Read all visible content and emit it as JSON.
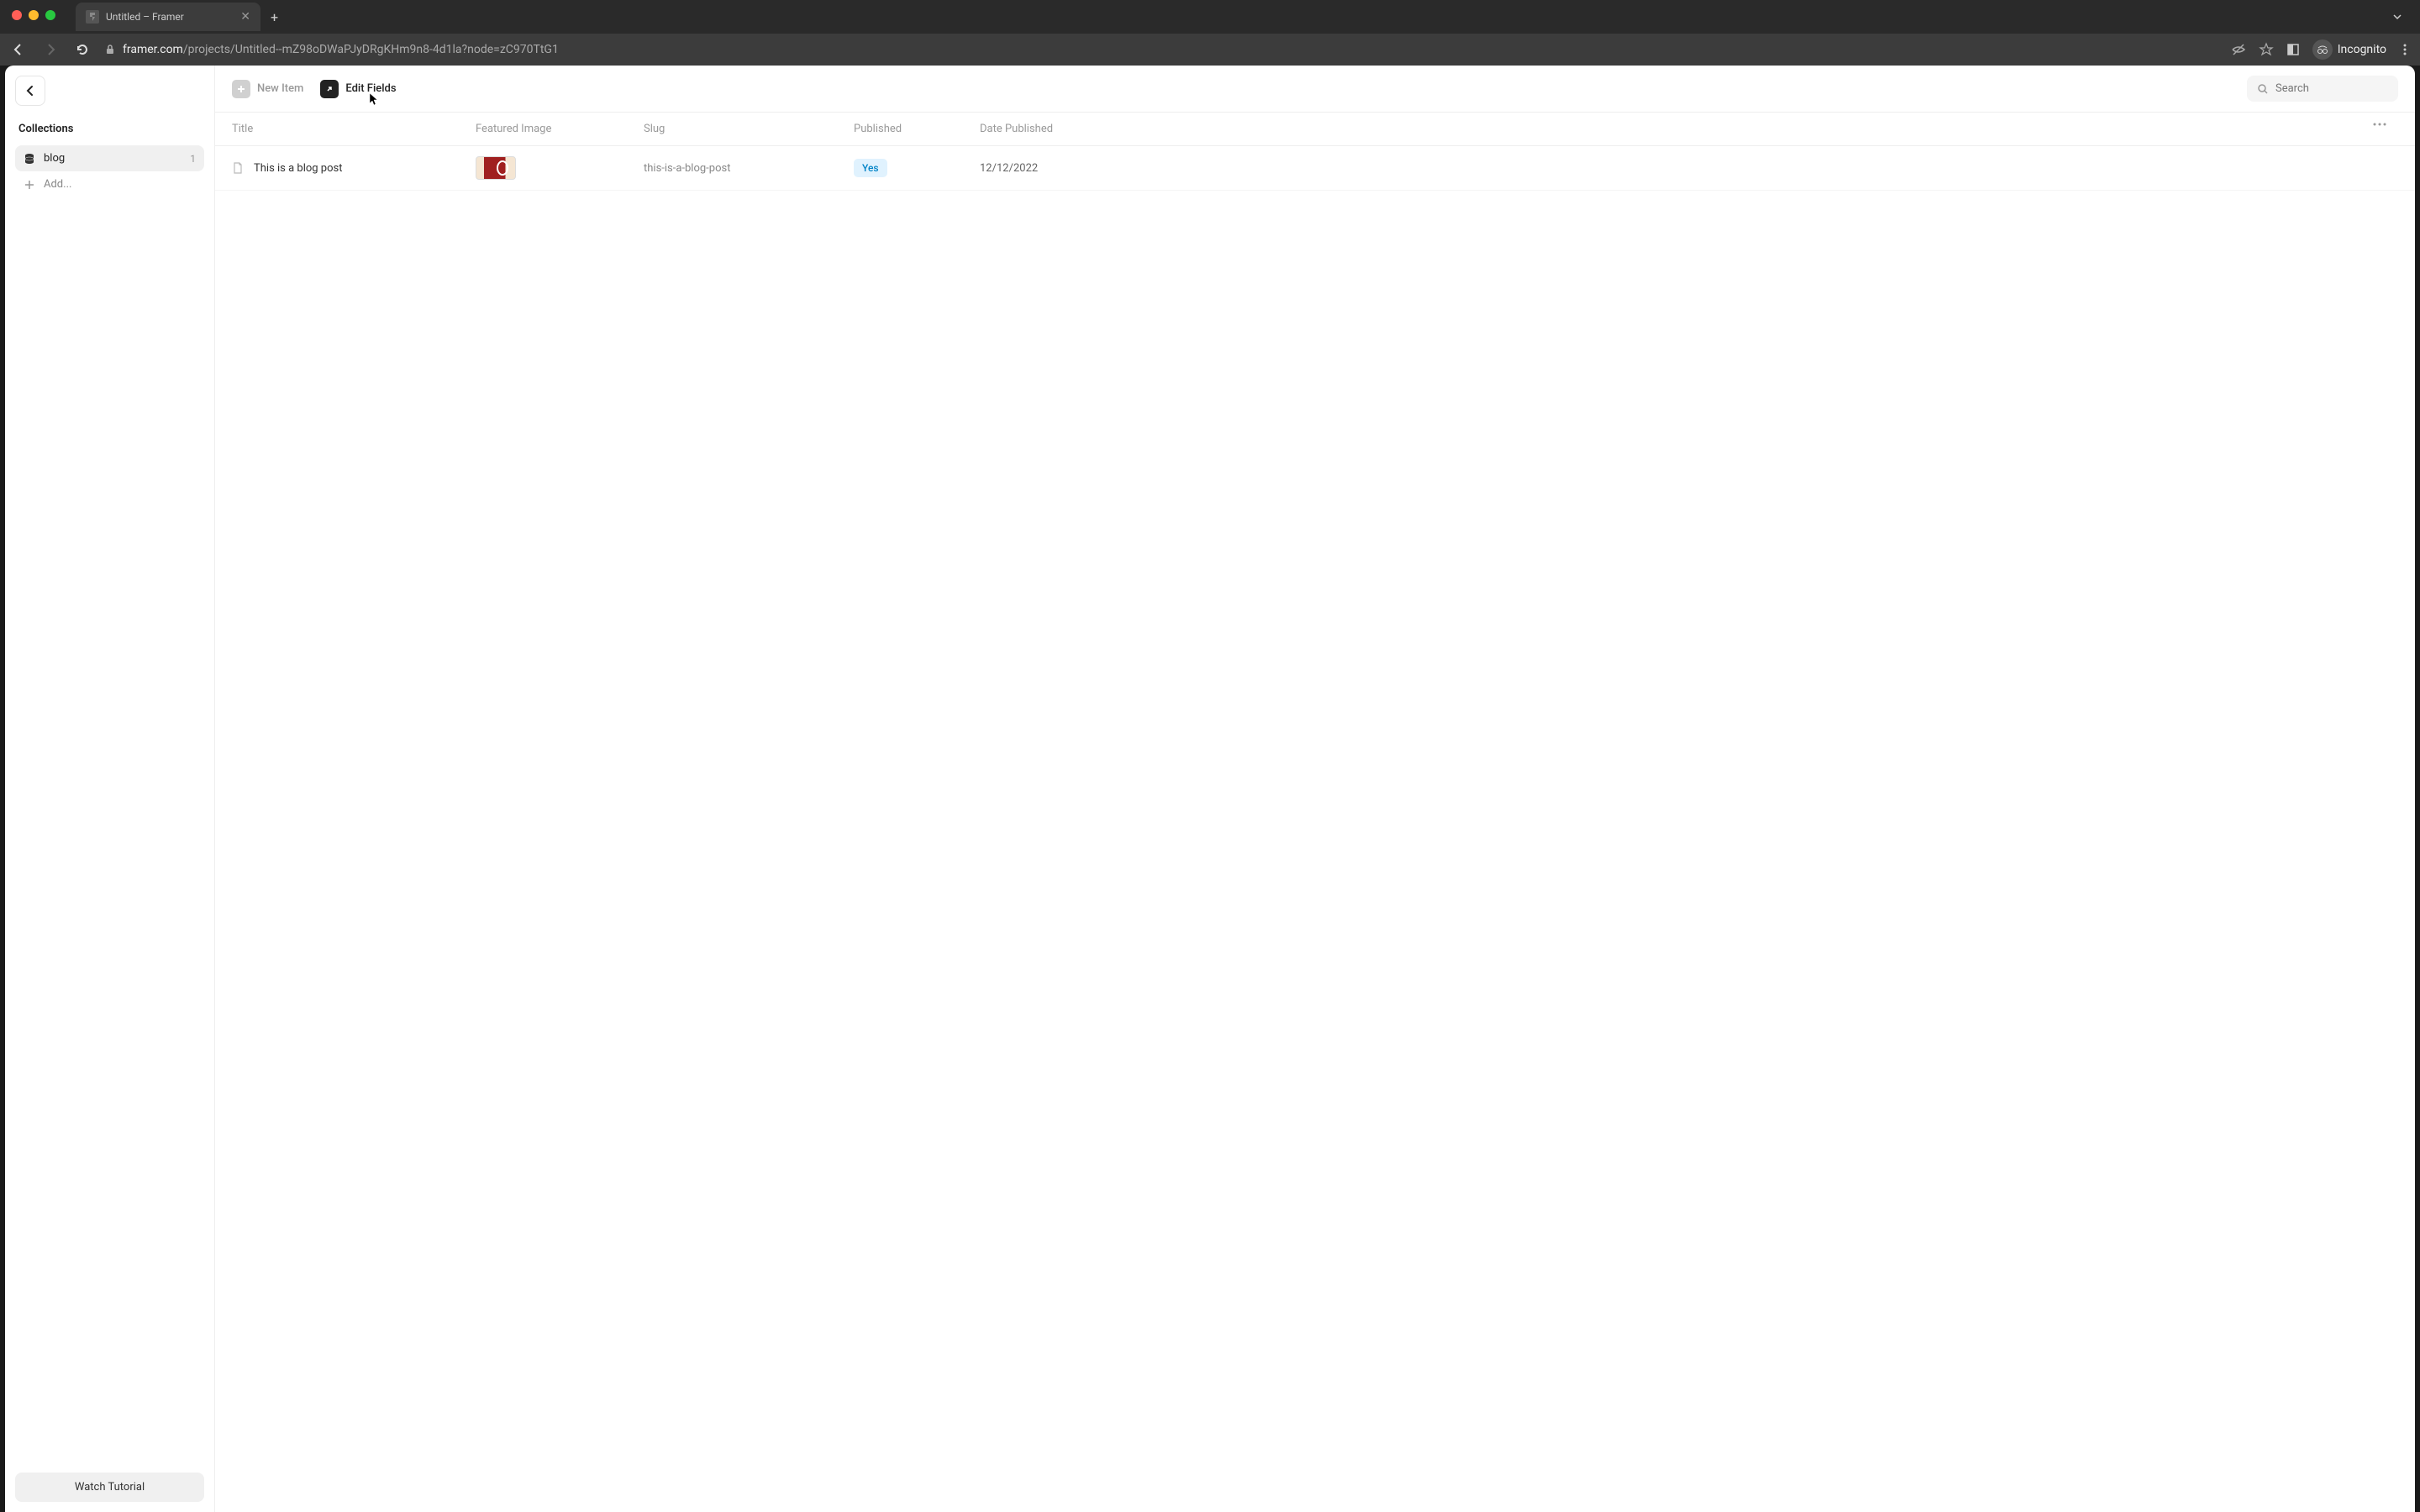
{
  "browser": {
    "tab_title": "Untitled – Framer",
    "url_domain": "framer.com",
    "url_path": "/projects/Untitled--mZ98oDWaPJyDRgKHm9n8-4d1la?node=zC970TtG1",
    "incognito_label": "Incognito"
  },
  "sidebar": {
    "heading": "Collections",
    "items": [
      {
        "name": "blog",
        "count": "1"
      }
    ],
    "add_label": "Add...",
    "watch_tutorial": "Watch Tutorial"
  },
  "toolbar": {
    "new_item": "New Item",
    "edit_fields": "Edit Fields",
    "search_placeholder": "Search"
  },
  "table": {
    "headers": {
      "title": "Title",
      "featured_image": "Featured Image",
      "slug": "Slug",
      "published": "Published",
      "date_published": "Date Published"
    },
    "rows": [
      {
        "title": "This is a blog post",
        "slug": "this-is-a-blog-post",
        "published": "Yes",
        "date": "12/12/2022"
      }
    ]
  }
}
